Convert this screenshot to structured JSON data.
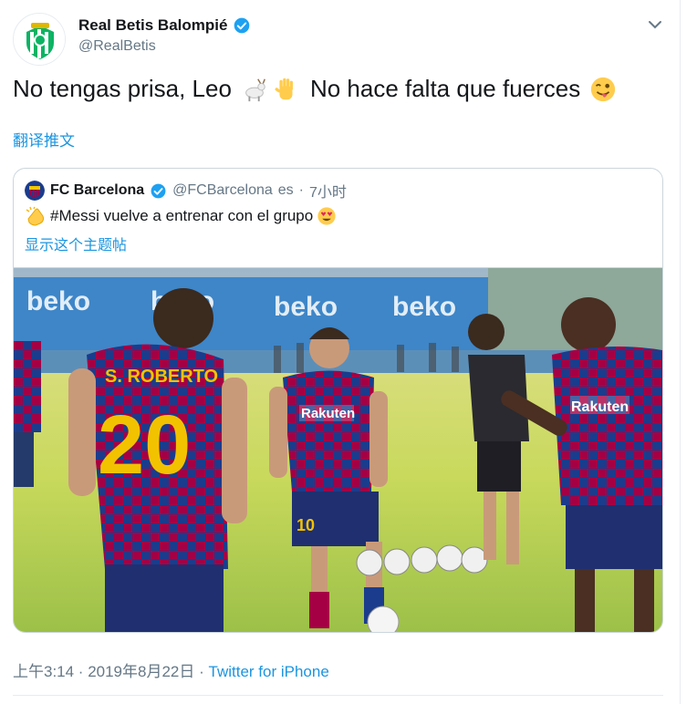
{
  "tweet": {
    "author_name": "Real Betis Balompié",
    "author_handle": "@RealBetis",
    "text_part1": "No tengas prisa, Leo",
    "text_part2": "No hace falta que fuerces",
    "emojis": [
      "goat-emoji",
      "raised-hand-emoji",
      "winking-tongue-emoji"
    ],
    "translate_label": "翻译推文",
    "timestamp": "上午3:14 · 2019年8月22日",
    "separator": " · ",
    "source": "Twitter for iPhone"
  },
  "quoted_tweet": {
    "author_name": "FC Barcelona",
    "author_handle": "@FCBarcelona",
    "lang": "es",
    "dot": "·",
    "time": "7小时",
    "text": "#Messi vuelve a entrenar con el grupo",
    "emojis": [
      "clapping-hands-emoji",
      "heart-eyes-emoji"
    ],
    "show_thread_label": "显示这个主题帖",
    "photo": {
      "banners": [
        "beko",
        "beko",
        "beko",
        "beko"
      ],
      "shirt_sponsor": "Rakuten",
      "player_back_name": "S. ROBERTO",
      "player_back_number": "20",
      "messi_short_number": "10"
    }
  },
  "colors": {
    "link": "#1b95e0",
    "verified": "#1da1f2",
    "muted": "#657786",
    "border": "#ccd6dd",
    "betis_green": "#0bb363",
    "barca_blue": "#1b3c8c",
    "barca_red": "#a50044"
  }
}
